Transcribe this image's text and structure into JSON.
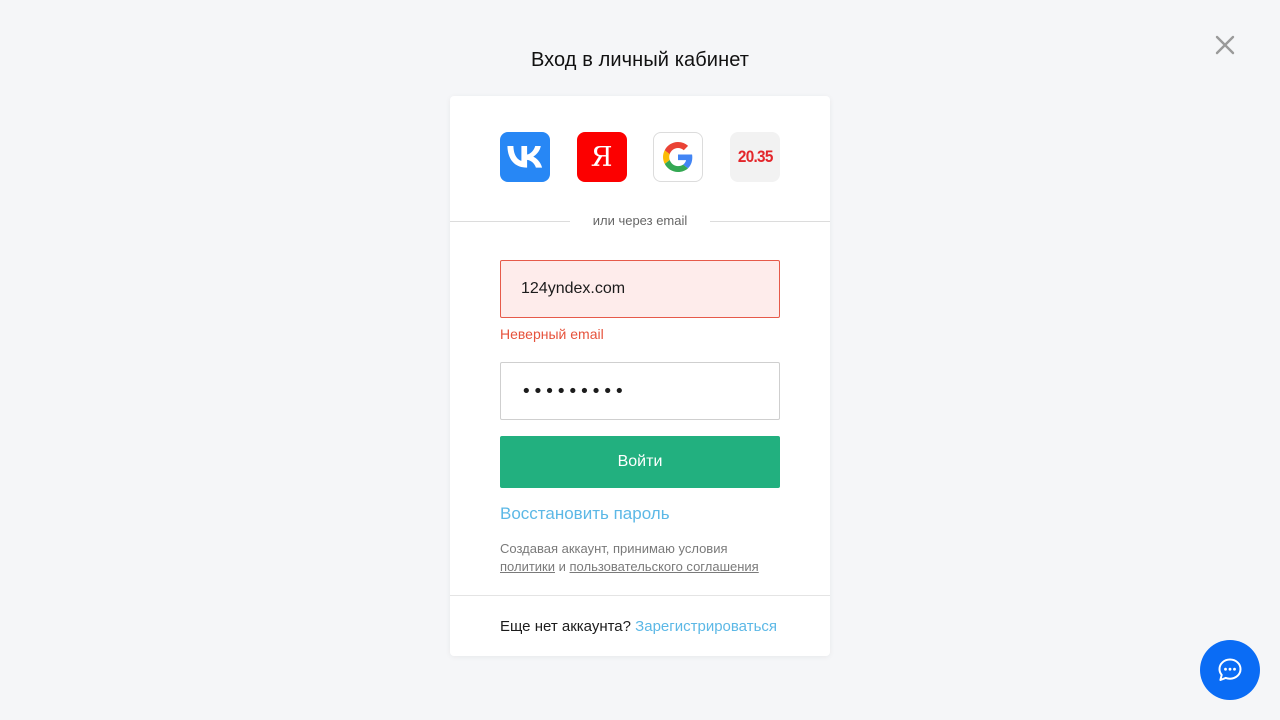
{
  "header": {
    "title": "Вход в личный кабинет"
  },
  "social": {
    "vk": {
      "icon": "vk-logo-icon",
      "color": "#2787f5"
    },
    "yandex": {
      "icon": "yandex-logo-icon",
      "letter": "Я",
      "color": "#fc0000"
    },
    "google": {
      "icon": "google-logo-icon"
    },
    "u2035": {
      "icon": "university-2035-logo-icon",
      "label": "20.35",
      "color": "#e3262b"
    }
  },
  "divider_text": "или через email",
  "form": {
    "email_value": "124yndex.com",
    "email_error": "Неверный email",
    "password_value": "•••••••••",
    "submit_label": "Войти",
    "restore_label": "Восстановить пароль"
  },
  "terms": {
    "text": "Создавая аккаунт, принимаю условия",
    "policy_link": "политики",
    "and": "и",
    "agreement_link": "пользовательского соглашения"
  },
  "footer": {
    "text": "Еще нет аккаунта?",
    "register_link": "Зарегистрироваться"
  },
  "colors": {
    "accent_green": "#22b07f",
    "link_blue": "#5cb8e6",
    "error_red": "#e6533c",
    "chat_blue": "#0a6cf5"
  },
  "icons": {
    "close": "close-icon",
    "chat": "chat-bubble-icon"
  }
}
